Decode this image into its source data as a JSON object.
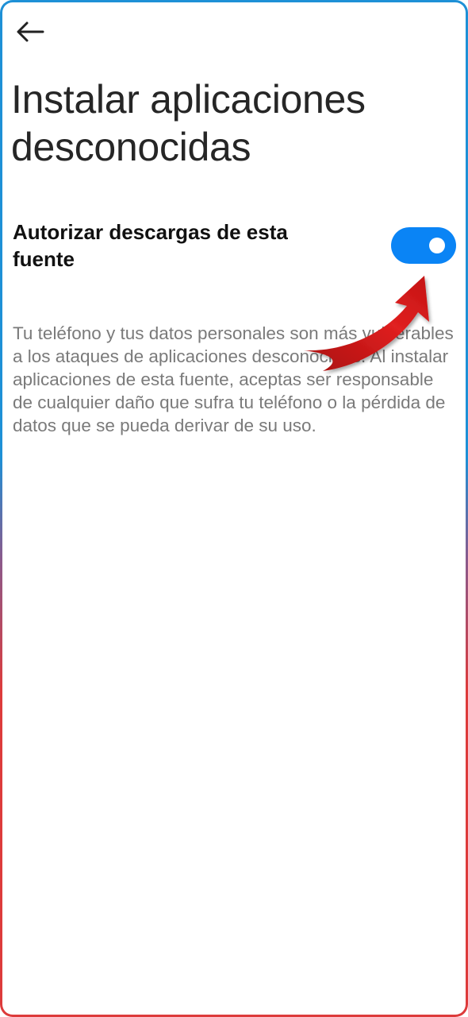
{
  "header": {
    "back_icon": "arrow-left-icon"
  },
  "page": {
    "title": "Instalar aplicaciones desconocidas"
  },
  "setting": {
    "label": "Autorizar descargas de esta fuente",
    "toggle_on": true,
    "toggle_color": "#0a84f5"
  },
  "description": {
    "text": "Tu teléfono y tus datos personales son más vulnerables a los ataques de aplicaciones desconocidas. Al instalar aplicaciones de esta fuente, aceptas ser responsable de cualquier daño que sufra tu teléfono o la pérdida de datos que se pueda derivar de su uso."
  },
  "annotation": {
    "icon": "red-curved-arrow-icon",
    "color": "#d01818"
  },
  "frame": {
    "border_top_color": "#1e90d6",
    "border_bottom_color": "#dd3b3b"
  }
}
